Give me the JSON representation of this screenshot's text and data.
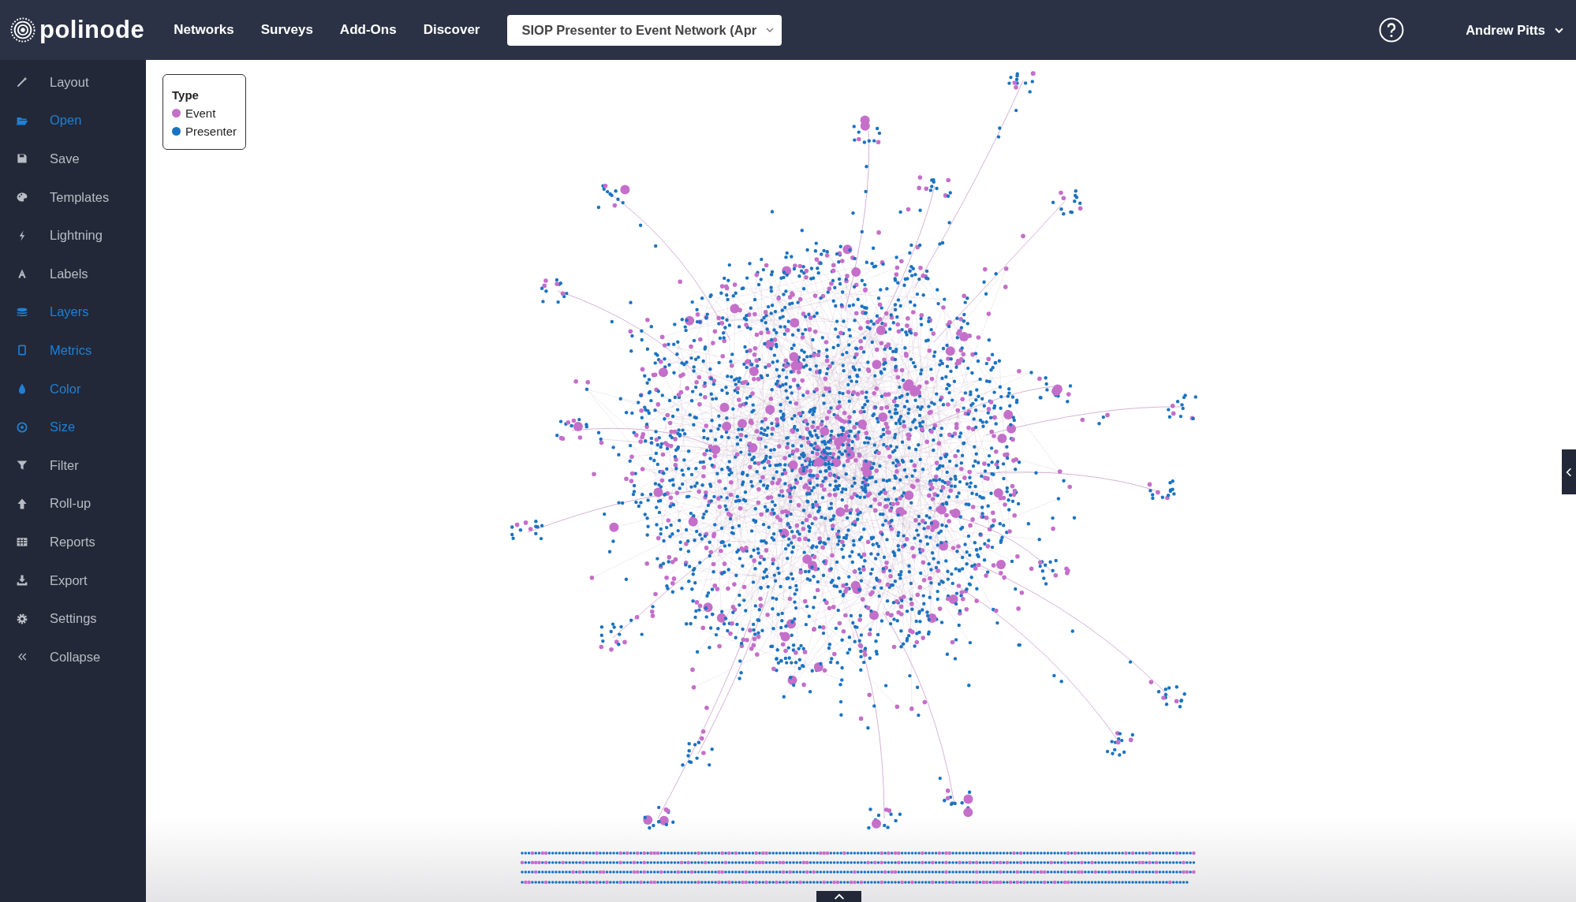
{
  "header": {
    "logo": "polinode",
    "nav": [
      "Networks",
      "Surveys",
      "Add-Ons",
      "Discover"
    ],
    "network_select": {
      "value": "SIOP Presenter to Event Network (Apr"
    },
    "user": "Andrew Pitts"
  },
  "sidebar": {
    "items": [
      {
        "label": "Layout",
        "active": false
      },
      {
        "label": "Open",
        "active": true
      },
      {
        "label": "Save",
        "active": false
      },
      {
        "label": "Templates",
        "active": false
      },
      {
        "label": "Lightning",
        "active": false
      },
      {
        "label": "Labels",
        "active": false
      },
      {
        "label": "Layers",
        "active": true
      },
      {
        "label": "Metrics",
        "active": true
      },
      {
        "label": "Color",
        "active": true
      },
      {
        "label": "Size",
        "active": true
      },
      {
        "label": "Filter",
        "active": false
      },
      {
        "label": "Roll-up",
        "active": false
      },
      {
        "label": "Reports",
        "active": false
      },
      {
        "label": "Export",
        "active": false
      },
      {
        "label": "Settings",
        "active": false
      },
      {
        "label": "Collapse",
        "active": false
      }
    ]
  },
  "legend": {
    "title": "Type",
    "items": [
      {
        "label": "Event",
        "color": "#c46fc9"
      },
      {
        "label": "Presenter",
        "color": "#1a73c2"
      }
    ]
  }
}
